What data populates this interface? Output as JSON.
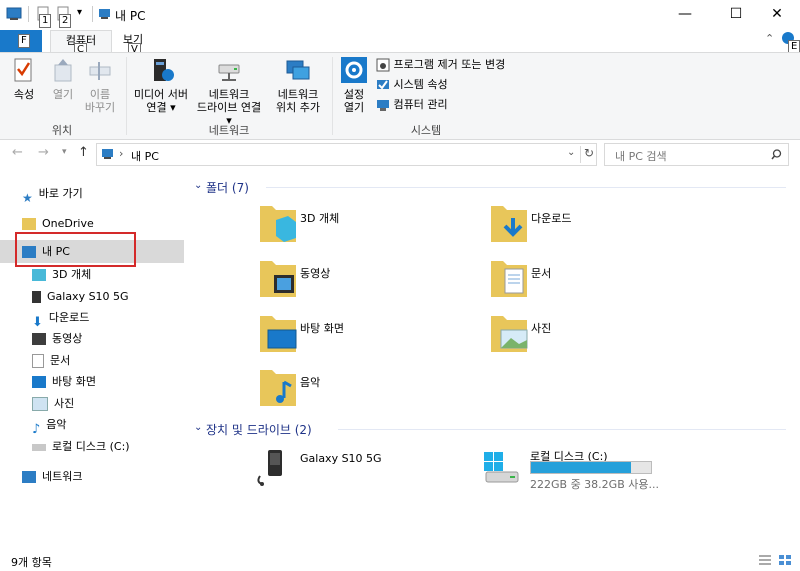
{
  "window": {
    "title": "내 PC",
    "keytips": {
      "qat1": "1",
      "qat2": "2",
      "file": "F",
      "computer": "C",
      "view": "V",
      "help": "E"
    },
    "controls": {
      "minimize": "—",
      "maximize": "☐",
      "close": "✕"
    }
  },
  "tabs": {
    "file": "",
    "computer": "컴퓨터",
    "view": "보기"
  },
  "ribbon": {
    "location": {
      "label": "위치",
      "properties": "속성",
      "open": "열기",
      "rename_line1": "이름",
      "rename_line2": "바꾸기"
    },
    "network": {
      "label": "네트워크",
      "media_line1": "미디어 서버",
      "media_line2": "연결 ▾",
      "map_line1": "네트워크",
      "map_line2": "드라이브 연결 ▾",
      "addloc_line1": "네트워크",
      "addloc_line2": "위치 추가"
    },
    "system": {
      "label": "시스템",
      "settings_line1": "설정",
      "settings_line2": "열기",
      "uninstall": "프로그램 제거 또는 변경",
      "sysprops": "시스템 속성",
      "manage": "컴퓨터 관리"
    }
  },
  "address": {
    "path": "내 PC",
    "search_placeholder": "내 PC 검색"
  },
  "nav": {
    "quick_access": "바로 가기",
    "onedrive": "OneDrive",
    "this_pc": "내 PC",
    "children": [
      "3D 개체",
      "Galaxy S10 5G",
      "다운로드",
      "동영상",
      "문서",
      "바탕 화면",
      "사진",
      "음악",
      "로컬 디스크 (C:)"
    ],
    "network": "네트워크"
  },
  "content": {
    "folders_header": "폴더 (7)",
    "folders": [
      "3D 개체",
      "다운로드",
      "동영상",
      "문서",
      "바탕 화면",
      "사진",
      "음악"
    ],
    "devices_header": "장치 및 드라이브 (2)",
    "devices": [
      {
        "name": "Galaxy S10 5G"
      },
      {
        "name": "로컬 디스크 (C:)",
        "detail": "222GB 중 38.2GB 사용...",
        "used_fraction": 0.83
      }
    ]
  },
  "status": {
    "items": "9개 항목"
  },
  "colors": {
    "accent": "#1979ca",
    "selection": "#d9d9d9",
    "highlight_box": "#d42a2a",
    "group_header": "#1e3287",
    "drive_bar": "#26a0da"
  }
}
